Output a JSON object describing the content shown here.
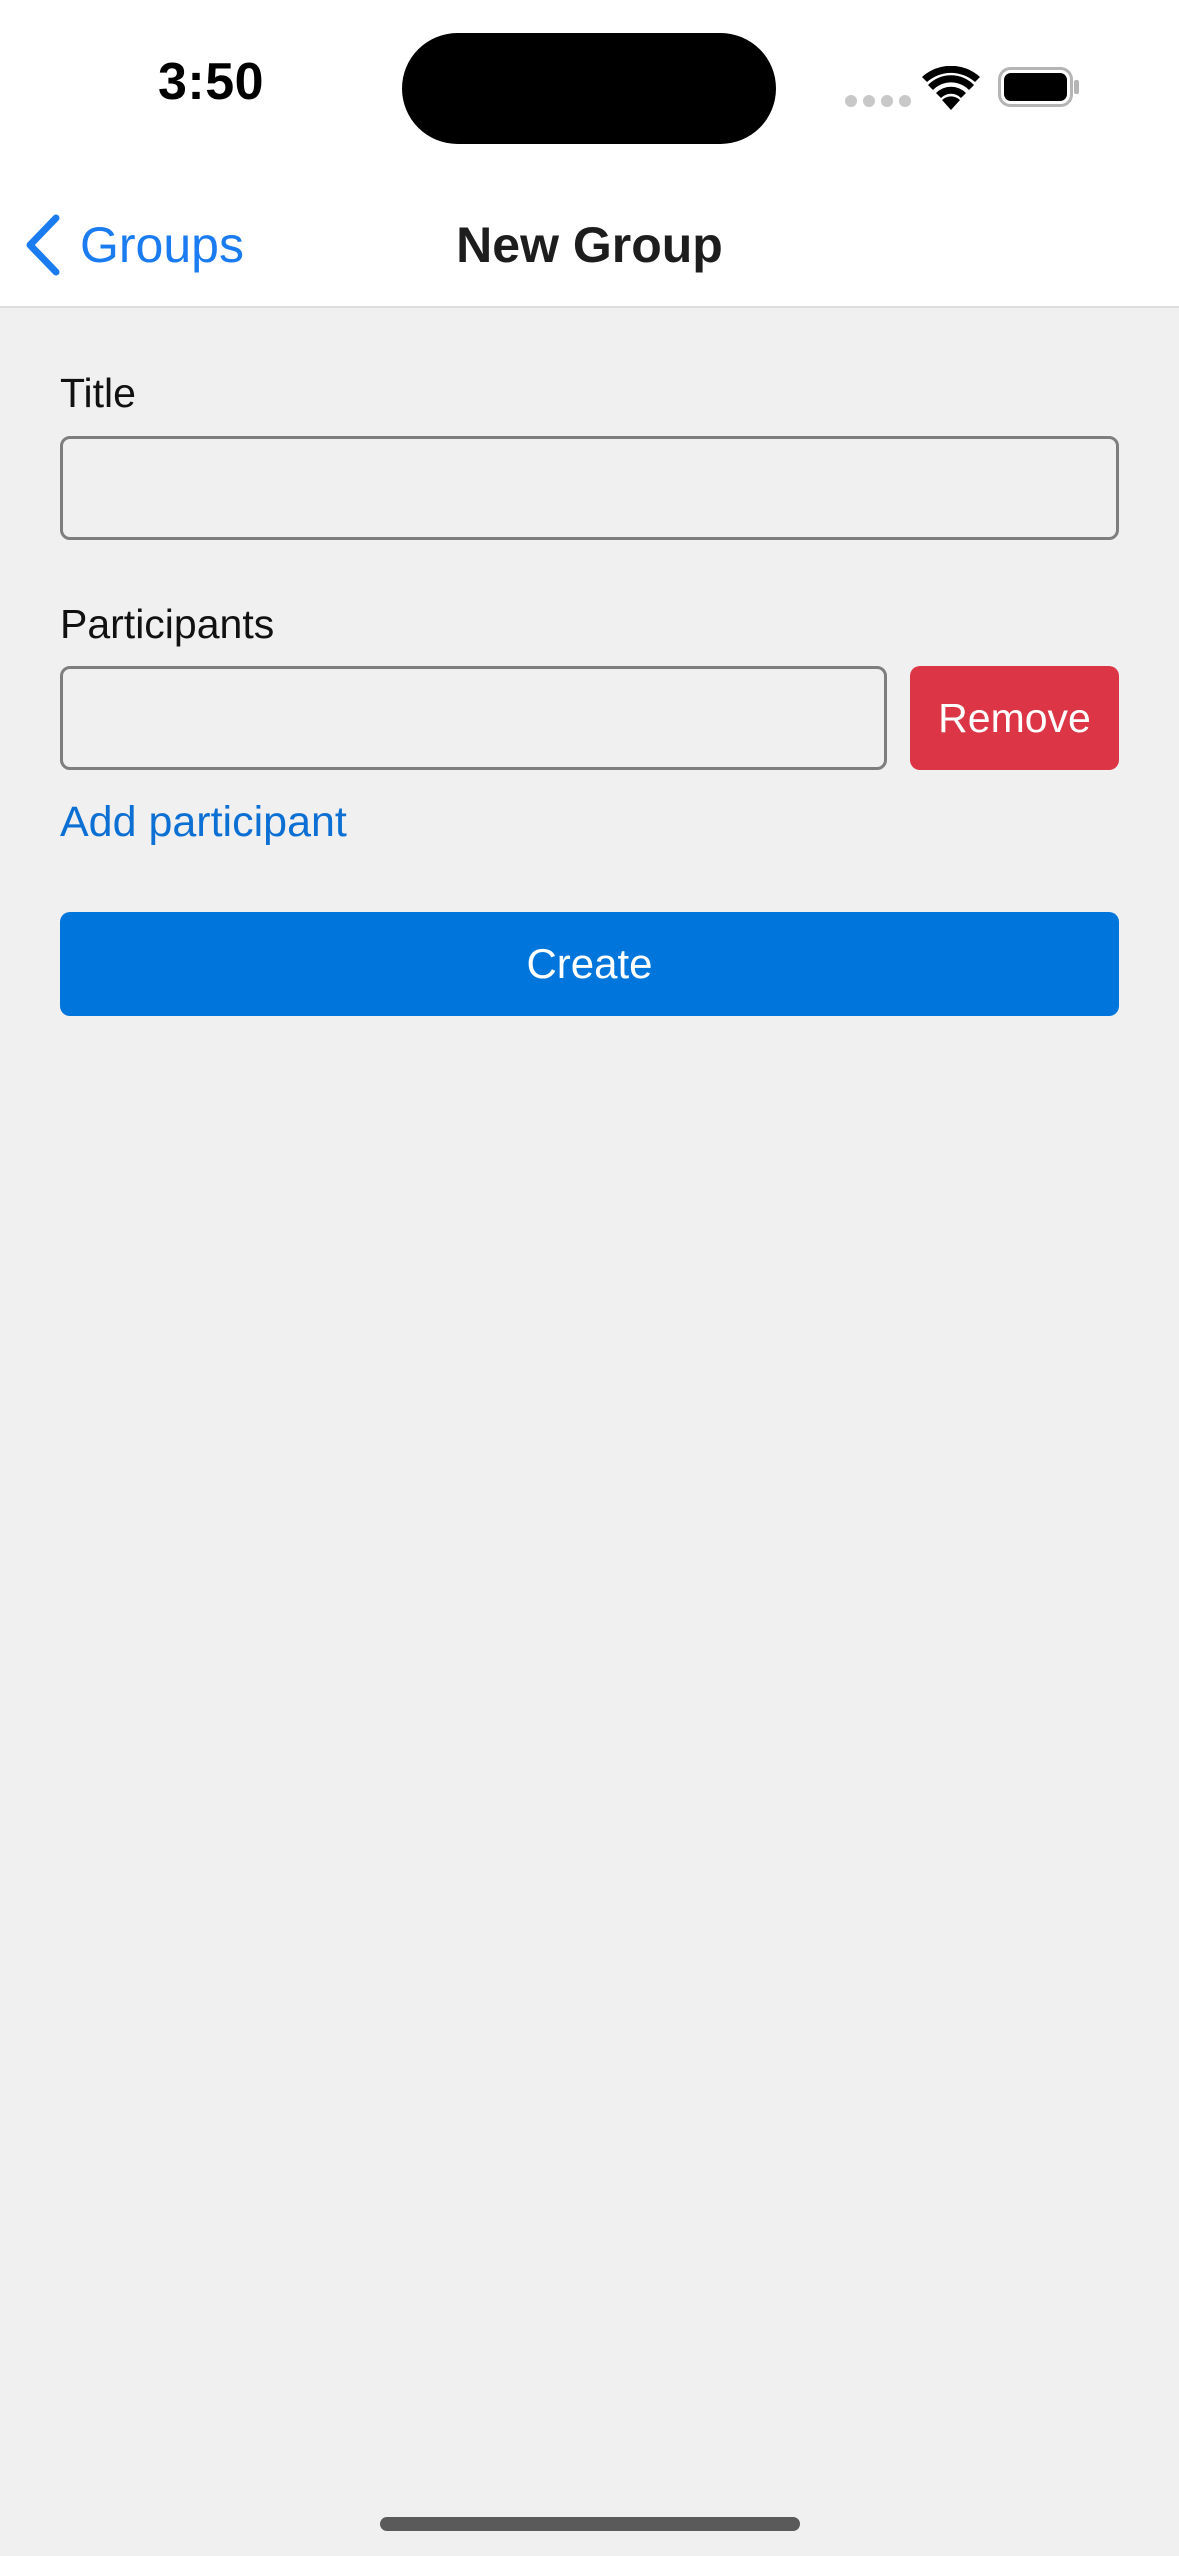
{
  "status_bar": {
    "time": "3:50"
  },
  "nav": {
    "back_label": "Groups",
    "title": "New Group"
  },
  "form": {
    "title_label": "Title",
    "title_value": "",
    "participants_label": "Participants",
    "participant_value": "",
    "remove_label": "Remove",
    "add_participant_label": "Add participant",
    "create_label": "Create"
  },
  "colors": {
    "accent": "#0076dd",
    "link": "#1a7cf0",
    "danger": "#dc3545",
    "background": "#f0f0f0"
  },
  "icons": {
    "back": "chevron-left-icon",
    "wifi": "wifi-icon",
    "battery": "battery-icon",
    "signal": "cellular-signal-icon"
  }
}
